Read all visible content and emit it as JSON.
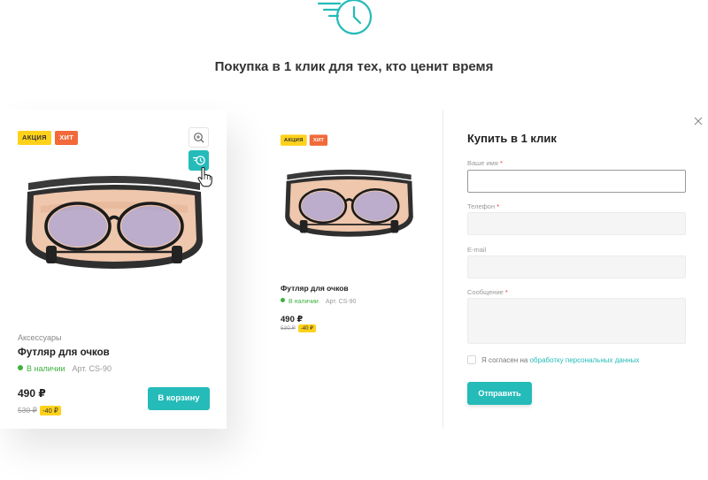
{
  "hero": {
    "title": "Покупка в 1 клик для тех, кто ценит время",
    "icon": "fast-clock-icon"
  },
  "product_card": {
    "badges": [
      "АКЦИЯ",
      "ХИТ"
    ],
    "category": "Аксессуары",
    "name": "Футляр для очков",
    "stock": "В наличии",
    "article": "Арт. CS-90",
    "price": "490 ₽",
    "old_price": "530 ₽",
    "discount": "-40 ₽",
    "cart_button": "В корзину",
    "zoom_icon": "zoom-icon",
    "quick_buy_icon": "quick-buy-icon"
  },
  "preview": {
    "badges": [
      "АКЦИЯ",
      "ХИТ"
    ],
    "name": "Футляр для очков",
    "stock": "В наличии",
    "article": "Арт. CS-90",
    "price": "490 ₽",
    "old_price": "530 ₽",
    "discount": "-40 ₽"
  },
  "modal": {
    "title": "Купить в 1 клик",
    "fields": {
      "name": "Ваше имя",
      "phone": "Телефон",
      "email": "E-mail",
      "message": "Сообщение"
    },
    "required_mark": "*",
    "consent_text": "Я согласен на",
    "consent_link": "обработку персональных данных",
    "submit": "Отправить"
  },
  "colors": {
    "accent": "#24bbb9",
    "sale": "#ffd11a",
    "hit": "#f26a3a",
    "in_stock": "#3fb13f"
  }
}
